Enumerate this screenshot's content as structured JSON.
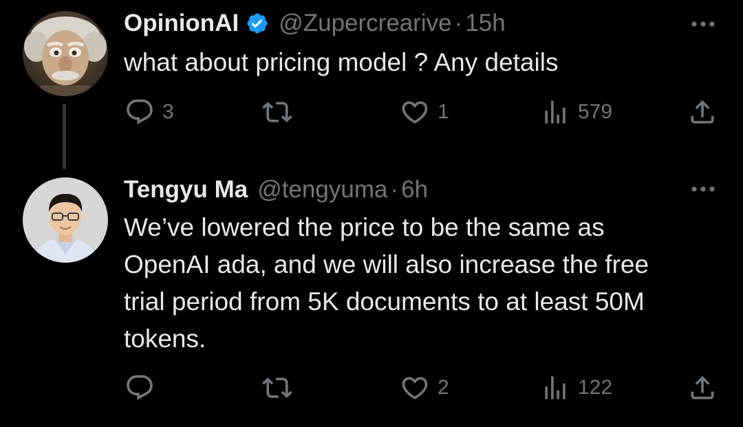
{
  "colors": {
    "background": "#000000",
    "text_primary": "#e7e9ea",
    "text_secondary": "#71767b",
    "verified_blue": "#1d9bf0",
    "thread_line": "#333639"
  },
  "tweets": [
    {
      "display_name": "OpinionAI",
      "verified": true,
      "verified_icon": "verified-badge-icon",
      "handle": "@Zupercrearive",
      "separator": "·",
      "time": "15h",
      "text": "what about pricing model ? Any details",
      "avatar": "avatar-puppet-einstein",
      "actions": {
        "reply_count": "3",
        "retweet_count": "",
        "like_count": "1",
        "views_count": "579"
      }
    },
    {
      "display_name": "Tengyu Ma",
      "verified": false,
      "handle": "@tengyuma",
      "separator": "·",
      "time": "6h",
      "text": "We’ve lowered the price to be the same as OpenAI ada, and we will also increase the free trial period from 5K documents to at least 50M tokens.",
      "avatar": "avatar-man-glasses",
      "actions": {
        "reply_count": "",
        "retweet_count": "",
        "like_count": "2",
        "views_count": "122"
      }
    }
  ]
}
